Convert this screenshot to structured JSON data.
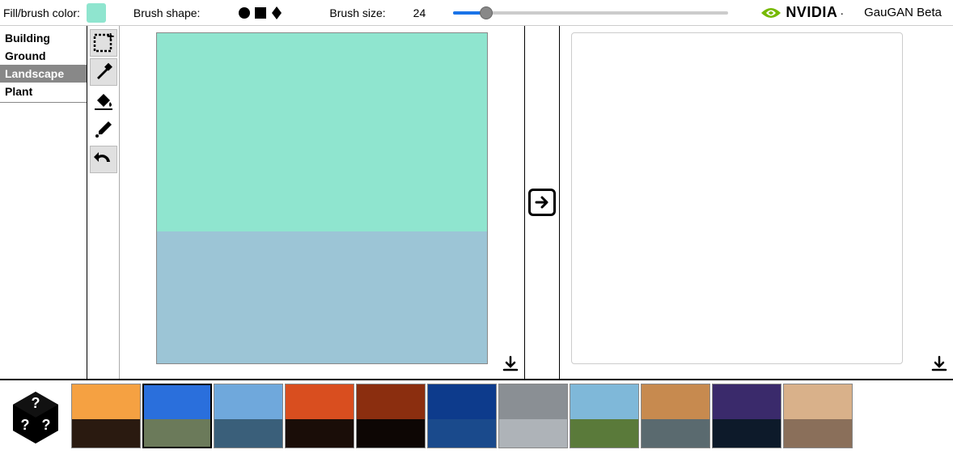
{
  "toolbar": {
    "color_label": "Fill/brush color:",
    "color_value": "#8fe5cf",
    "shape_label": "Brush shape:",
    "size_label": "Brush size:",
    "size_value": "24",
    "slider_percent": 12
  },
  "brand": {
    "logo_text": "NVIDIA",
    "app_title": "GauGAN Beta"
  },
  "categories": [
    {
      "label": "Building",
      "selected": false
    },
    {
      "label": "Ground",
      "selected": false
    },
    {
      "label": "Landscape",
      "selected": true
    },
    {
      "label": "Plant",
      "selected": false
    }
  ],
  "tools": [
    {
      "name": "new-canvas",
      "highlighted": true
    },
    {
      "name": "brush",
      "highlighted": true
    },
    {
      "name": "fill",
      "highlighted": false
    },
    {
      "name": "eyedropper",
      "highlighted": false
    },
    {
      "name": "undo",
      "highlighted": true
    }
  ],
  "segmentation": {
    "top_color": "#8fe5cf",
    "top_height_pct": 60,
    "bottom_color": "#9cc5d6",
    "bottom_height_pct": 40
  },
  "thumbnails": [
    {
      "name": "random-dice"
    },
    {
      "name": "sunset-orange",
      "sky": "#f5a142",
      "ground": "#2a1a10"
    },
    {
      "name": "road-blue-sky",
      "sky": "#2a6fdc",
      "ground": "#6b7a5a",
      "selected": true
    },
    {
      "name": "ocean-clouds",
      "sky": "#6fa8dc",
      "ground": "#3a5f7a"
    },
    {
      "name": "sunset-red",
      "sky": "#d94e1f",
      "ground": "#1a0d08"
    },
    {
      "name": "dusk-dark-red",
      "sky": "#8b2e0f",
      "ground": "#0d0604"
    },
    {
      "name": "lake-deep-blue",
      "sky": "#0d3b8c",
      "ground": "#1a4a8c"
    },
    {
      "name": "grey-storm",
      "sky": "#8a8f94",
      "ground": "#aeb3b8"
    },
    {
      "name": "green-hills",
      "sky": "#7fb8d9",
      "ground": "#5a7a3a"
    },
    {
      "name": "golden-clouds",
      "sky": "#c78a4f",
      "ground": "#5a6a6f"
    },
    {
      "name": "purple-sunset",
      "sky": "#3a2a6b",
      "ground": "#0d1a2a"
    },
    {
      "name": "pale-sunset",
      "sky": "#d9b18a",
      "ground": "#8a6f5a"
    }
  ]
}
